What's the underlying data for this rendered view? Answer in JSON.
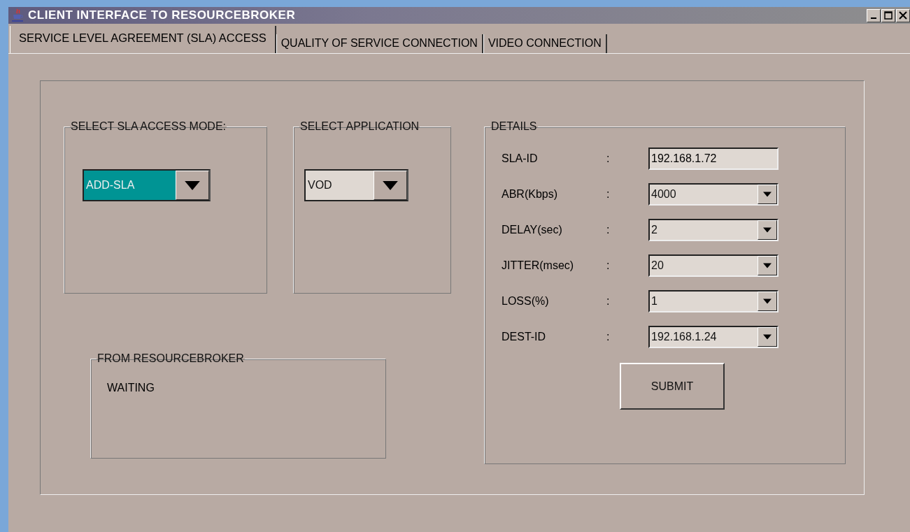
{
  "window": {
    "title": "CLIENT INTERFACE TO RESOURCEBROKER"
  },
  "tabs": [
    {
      "label": "SERVICE LEVEL AGREEMENT (SLA) ACCESS",
      "selected": true
    },
    {
      "label": "QUALITY OF SERVICE CONNECTION",
      "selected": false
    },
    {
      "label": "VIDEO CONNECTION",
      "selected": false
    }
  ],
  "access_mode": {
    "title": "SELECT SLA ACCESS MODE:",
    "value": "ADD-SLA",
    "focused": true
  },
  "application": {
    "title": "SELECT APPLICATION",
    "value": "VOD",
    "focused": false
  },
  "resourcebroker": {
    "title": "FROM RESOURCEBROKER",
    "message": "WAITING"
  },
  "details": {
    "title": "DETAILS",
    "fields": [
      {
        "label": "SLA-ID",
        "colon": ":",
        "kind": "text",
        "value": "192.168.1.72"
      },
      {
        "label": "ABR(Kbps)",
        "colon": ":",
        "kind": "dropdown",
        "value": "4000"
      },
      {
        "label": "DELAY(sec)",
        "colon": ":",
        "kind": "dropdown",
        "value": "2"
      },
      {
        "label": "JITTER(msec)",
        "colon": ":",
        "kind": "dropdown",
        "value": "20"
      },
      {
        "label": "LOSS(%)",
        "colon": ":",
        "kind": "dropdown",
        "value": "1"
      },
      {
        "label": "DEST-ID",
        "colon": ":",
        "kind": "dropdown",
        "value": "192.168.1.24"
      }
    ],
    "submit": "SUBMIT"
  }
}
